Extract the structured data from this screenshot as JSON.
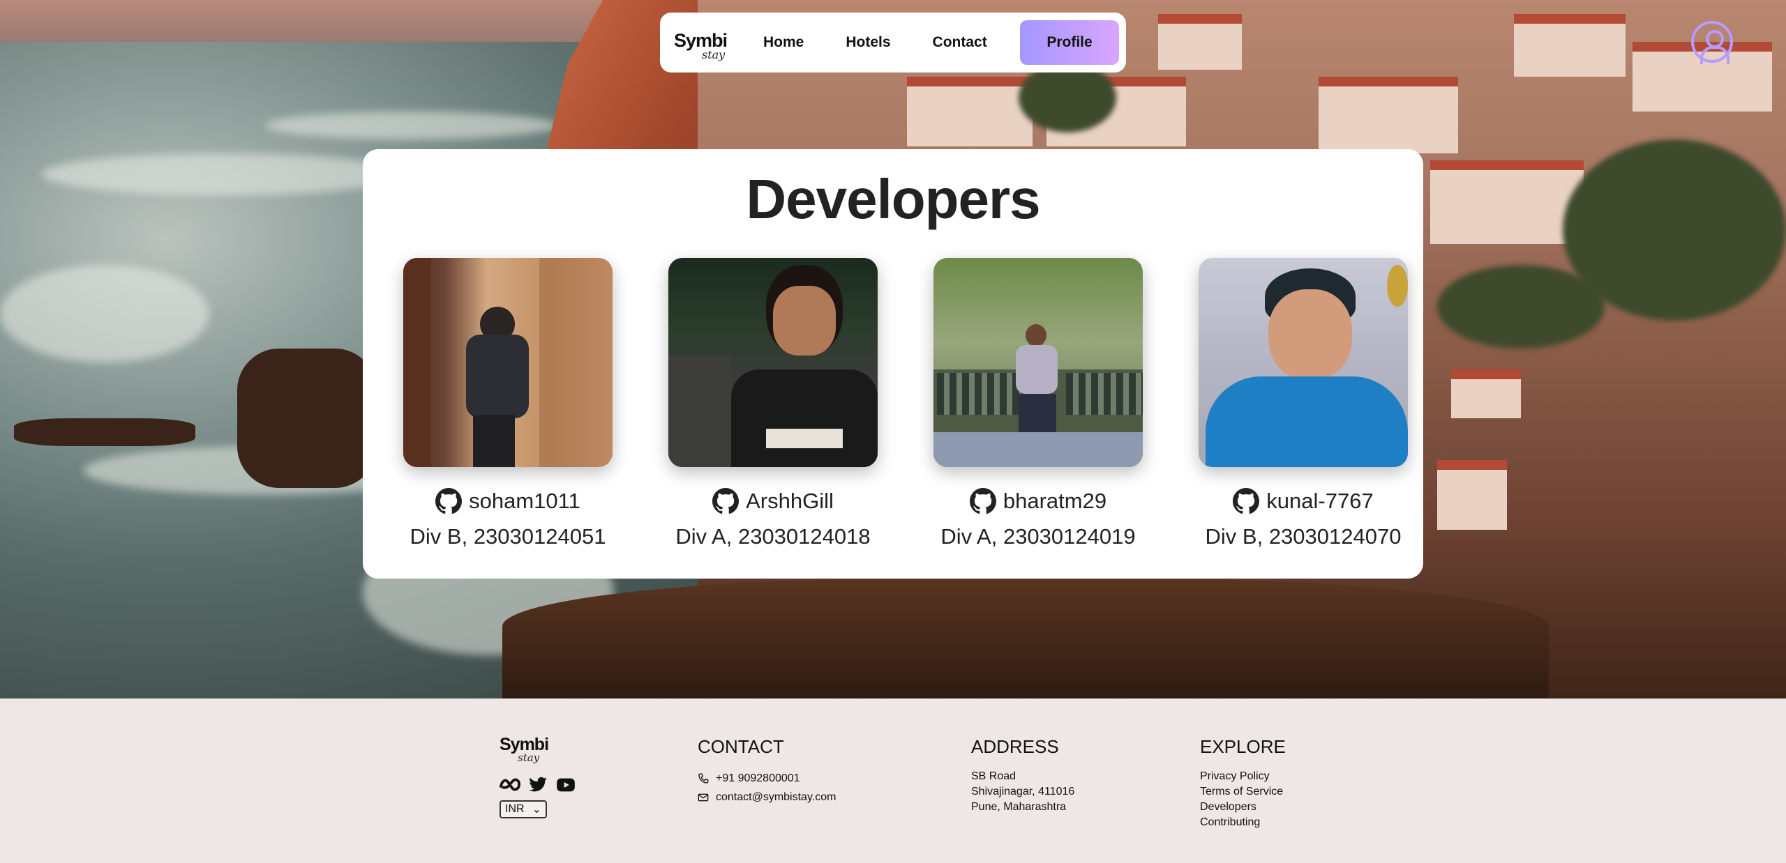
{
  "nav": {
    "logo_main": "Symbi",
    "logo_sub": "stay",
    "home": "Home",
    "hotels": "Hotels",
    "contact": "Contact",
    "profile": "Profile"
  },
  "developers": {
    "title": "Developers",
    "people": [
      {
        "github": "soham1011",
        "info": "Div B, 23030124051"
      },
      {
        "github": "ArshhGill",
        "info": "Div A, 23030124018"
      },
      {
        "github": "bharatm29",
        "info": "Div A, 23030124019"
      },
      {
        "github": "kunal-7767",
        "info": "Div B, 23030124070"
      }
    ]
  },
  "footer": {
    "logo_main": "Symbi",
    "logo_sub": "stay",
    "socials": [
      "meta-icon",
      "twitter-icon",
      "youtube-icon"
    ],
    "currency": "INR",
    "contact": {
      "heading": "CONTACT",
      "phone": "+91 9092800001",
      "email": "contact@symbistay.com"
    },
    "address": {
      "heading": "ADDRESS",
      "lines": [
        "SB Road",
        "Shivajinagar, 411016",
        "Pune, Maharashtra"
      ]
    },
    "explore": {
      "heading": "EXPLORE",
      "links": [
        "Privacy Policy",
        "Terms of Service",
        "Developers",
        "Contributing"
      ]
    }
  },
  "colors": {
    "profile_gradient_start": "#a497ff",
    "profile_gradient_end": "#d9a6ff",
    "footer_bg": "#efe6e6"
  }
}
